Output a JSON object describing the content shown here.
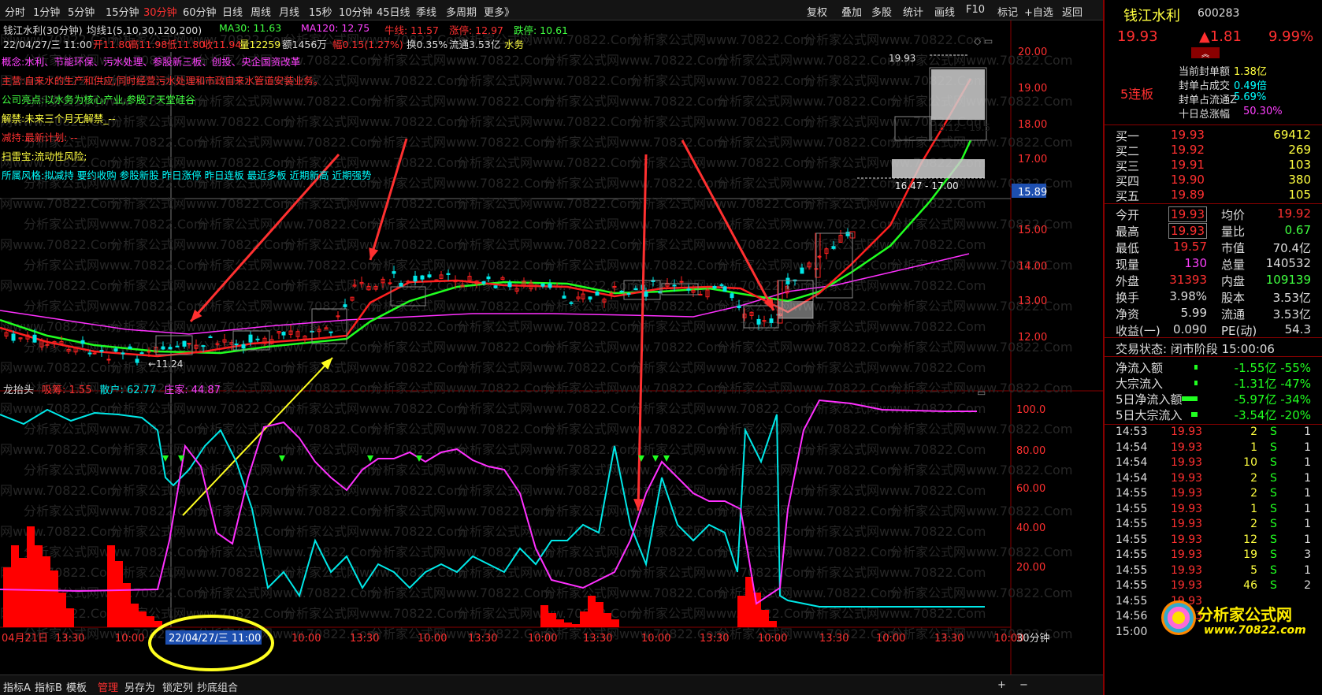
{
  "toolbar": {
    "tabs": [
      "分时",
      "1分钟",
      "5分钟",
      "15分钟",
      "30分钟",
      "60分钟",
      "日线",
      "周线",
      "月线",
      "15秒",
      "10分钟",
      "45日线",
      "季线",
      "多周期",
      "更多》"
    ],
    "active": "30分钟",
    "right": [
      "复权",
      "叠加",
      "多股",
      "统计",
      "画线",
      "F10",
      "标记",
      "+自选",
      "返回"
    ]
  },
  "header": {
    "title": "钱江水利(30分钟)",
    "ma_label": "均线1(5,10,30,120,200)",
    "ma30": "MA30: 11.63",
    "ma120": "MA120: 12.75",
    "niuxian": "牛线: 11.57",
    "zhangting": "涨停: 12.97",
    "dieting": "跌停: 10.61",
    "bar_date": "22/04/27/三 11:00",
    "open": "开11.80",
    "high": "高11.98",
    "low": "低11.80",
    "close": "收11.94",
    "vol": "量12259",
    "amount": "额1456万",
    "range": "幅0.15(1.27%)",
    "turnover": "换0.35%",
    "float": "流通3.53亿",
    "tag": "水务"
  },
  "notes": [
    {
      "label": "概念:",
      "text": "水利、节能环保、污水处理、参股新三板、创投、央企国资改革",
      "color": "#ff40ff"
    },
    {
      "label": "主营:",
      "text": "自来水的生产和供应,同时经营污水处理和市政自来水管道安装业务。",
      "color": "#ff3030"
    },
    {
      "label": "公司亮点:",
      "text": "以水务为核心产业,参股了天堂硅谷",
      "color": "#40ff40"
    },
    {
      "label": "解禁:",
      "text": "未来三个月无解禁_--",
      "color": "#ffff40"
    },
    {
      "label": "减持:",
      "text": "最新计划: --",
      "color": "#ff3030"
    },
    {
      "label": "扫雷宝:",
      "text": "流动性风险;",
      "color": "#ffff40"
    },
    {
      "label": "所属风格:",
      "text": "拟减持 要约收购 参股新股 昨日涨停 昨日连板 最近多板 近期新高 近期强势",
      "color": "#00ffff"
    }
  ],
  "price_axis": [
    "20.00",
    "19.00",
    "18.00",
    "17.00",
    "15.89",
    "15.00",
    "14.00",
    "13.00",
    "12.00"
  ],
  "price_marks": {
    "hi": "19.93",
    "lo": "←11.24",
    "box1": "18.12 - 19.5",
    "box2": "16.47 - 17.00"
  },
  "indicator": {
    "name": "龙抬头",
    "xichou": "吸筹: 1.55",
    "sanhu": "散户: 62.77",
    "zhuangjia": "庄家: 44.87",
    "axis": [
      "100.0",
      "80.00",
      "60.00",
      "40.00",
      "20.00"
    ]
  },
  "time_axis": [
    "04月21日",
    "13:30",
    "10:00",
    "13:30",
    "10:00",
    "13:30",
    "10:00",
    "13:30",
    "10:00",
    "13:30",
    "10:00",
    "13:30",
    "10:00",
    "13:30",
    "10:00",
    "13:30",
    "10:00"
  ],
  "cursor_date": "22/04/27/三 11:00",
  "period_label": "30分钟",
  "bottom": [
    "指标A",
    "指标B",
    "模板",
    "管理",
    "另存为",
    "锁定列",
    "抄底组合"
  ],
  "watermark": "分析家公式网www.70822.Com",
  "quote": {
    "name": "钱江水利",
    "code": "600283",
    "price": "19.93",
    "change": "▲1.81",
    "pct": "9.99%",
    "lianban": "5连板",
    "seal": [
      {
        "k": "当前封单额",
        "v": "1.38亿",
        "c": "#ffff40"
      },
      {
        "k": "封单占成交",
        "v": "0.49倍",
        "c": "#00ffff"
      },
      {
        "k": "封单占流通Z",
        "v": "5.69%",
        "c": "#00ffff"
      },
      {
        "k": "十日总涨幅",
        "v": "50.30%",
        "c": "#ff40ff"
      }
    ],
    "bids": [
      {
        "k": "买一",
        "p": "19.93",
        "v": "69412"
      },
      {
        "k": "买二",
        "p": "19.92",
        "v": "269"
      },
      {
        "k": "买三",
        "p": "19.91",
        "v": "103"
      },
      {
        "k": "买四",
        "p": "19.90",
        "v": "380"
      },
      {
        "k": "买五",
        "p": "19.89",
        "v": "105"
      }
    ],
    "stats": [
      {
        "k1": "今开",
        "v1": "19.93",
        "c1": "#ff3030",
        "k2": "均价",
        "v2": "19.92",
        "c2": "#ff3030"
      },
      {
        "k1": "最高",
        "v1": "19.93",
        "c1": "#ff3030",
        "k2": "量比",
        "v2": "0.67",
        "c2": "#40ff40"
      },
      {
        "k1": "最低",
        "v1": "19.57",
        "c1": "#ff3030",
        "k2": "市值",
        "v2": "70.4亿",
        "c2": "#ddd"
      },
      {
        "k1": "现量",
        "v1": "130",
        "c1": "#ff40ff",
        "k2": "总量",
        "v2": "140532",
        "c2": "#ddd"
      },
      {
        "k1": "外盘",
        "v1": "31393",
        "c1": "#ff3030",
        "k2": "内盘",
        "v2": "109139",
        "c2": "#40ff40"
      },
      {
        "k1": "换手",
        "v1": "3.98%",
        "c1": "#ddd",
        "k2": "股本",
        "v2": "3.53亿",
        "c2": "#ddd"
      },
      {
        "k1": "净资",
        "v1": "5.99",
        "c1": "#ddd",
        "k2": "流通",
        "v2": "3.53亿",
        "c2": "#ddd"
      },
      {
        "k1": "收益(一)",
        "v1": "0.090",
        "c1": "#ddd",
        "k2": "PE(动)",
        "v2": "54.3",
        "c2": "#ddd"
      }
    ],
    "status": "交易状态: 闭市阶段 15:00:06",
    "flows": [
      {
        "k": "净流入额",
        "v": "-1.55亿 -55%"
      },
      {
        "k": "大宗流入",
        "v": "-1.31亿 -47%"
      },
      {
        "k": "5日净流入额",
        "v": "-5.97亿 -34%"
      },
      {
        "k": "5日大宗流入",
        "v": "-3.54亿 -20%"
      }
    ],
    "ticks": [
      {
        "t": "14:53",
        "p": "19.93",
        "v": "2",
        "s": "S",
        "n": "1"
      },
      {
        "t": "14:54",
        "p": "19.93",
        "v": "1",
        "s": "S",
        "n": "1"
      },
      {
        "t": "14:54",
        "p": "19.93",
        "v": "10",
        "s": "S",
        "n": "1"
      },
      {
        "t": "14:54",
        "p": "19.93",
        "v": "2",
        "s": "S",
        "n": "1"
      },
      {
        "t": "14:55",
        "p": "19.93",
        "v": "2",
        "s": "S",
        "n": "1"
      },
      {
        "t": "14:55",
        "p": "19.93",
        "v": "1",
        "s": "S",
        "n": "1"
      },
      {
        "t": "14:55",
        "p": "19.93",
        "v": "2",
        "s": "S",
        "n": "1"
      },
      {
        "t": "14:55",
        "p": "19.93",
        "v": "12",
        "s": "S",
        "n": "1"
      },
      {
        "t": "14:55",
        "p": "19.93",
        "v": "19",
        "s": "S",
        "n": "3"
      },
      {
        "t": "14:55",
        "p": "19.93",
        "v": "5",
        "s": "S",
        "n": "1"
      },
      {
        "t": "14:55",
        "p": "19.93",
        "v": "46",
        "s": "S",
        "n": "2"
      },
      {
        "t": "14:55",
        "p": "19.93",
        "v": "",
        "s": "",
        "n": ""
      },
      {
        "t": "14:56",
        "p": "19.93",
        "v": "",
        "s": "",
        "n": ""
      },
      {
        "t": "15:00",
        "p": "",
        "v": "",
        "s": "",
        "n": ""
      }
    ],
    "logo": "分析家公式网",
    "logo_url": "www.70822.com"
  }
}
